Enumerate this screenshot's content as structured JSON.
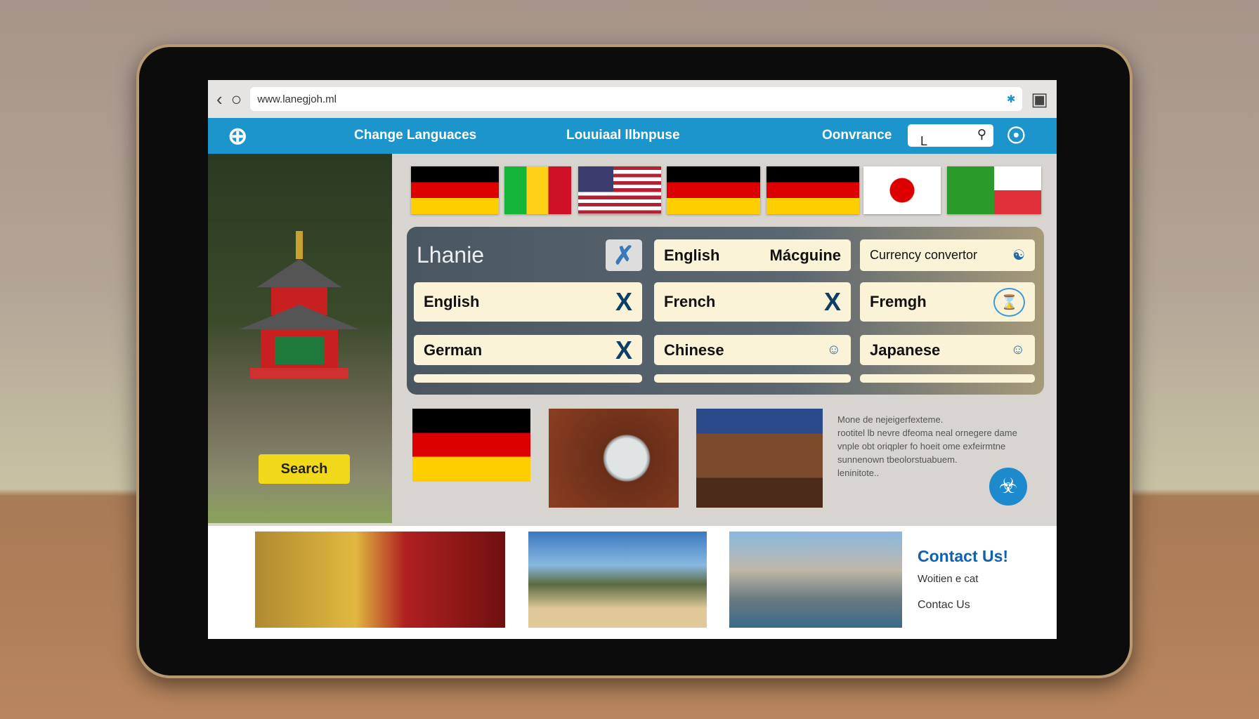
{
  "browser": {
    "url": "www.lanegjoh.ml",
    "back_icon": "chevron-left-icon",
    "reload_icon": "circle-icon",
    "extension_icon": "puzzle-icon",
    "camera_icon": "camera-icon"
  },
  "nav": {
    "logo_icon": "globe-icon",
    "items": [
      "Change Languaces",
      "Louuiaal llbnpuse",
      "Oonvrance"
    ],
    "search_value": "L",
    "search_icon": "search-icon",
    "profile_icon": "location-badge-icon",
    "color": "#1c95cc"
  },
  "left": {
    "search_label": "Search"
  },
  "flags": [
    "germany",
    "mali",
    "usa",
    "germany",
    "germany",
    "japan",
    "green-red"
  ],
  "panel": {
    "title": "Lhanie",
    "cells": [
      {
        "label": "English",
        "extra": "Mácguine"
      },
      {
        "label": "Currency convertor"
      },
      {
        "label": "English"
      },
      {
        "label": "French"
      },
      {
        "label": "Fremgh"
      },
      {
        "label": "German"
      },
      {
        "label": "Chinese"
      },
      {
        "label": "Japanese"
      }
    ]
  },
  "description": {
    "lines": [
      "Mone de nejeigerfexteme.",
      "rootitel lb nevre dfeoma neal ornegere dame",
      "vnple obt oriqpler fo hoeit ome exfeirmtne",
      "sunnenown tbeolorstuabuem.",
      "leninitote.."
    ]
  },
  "contact": {
    "title": "Contact Us!",
    "subtitle": "Woitien e cat",
    "link": "Contac Us"
  }
}
